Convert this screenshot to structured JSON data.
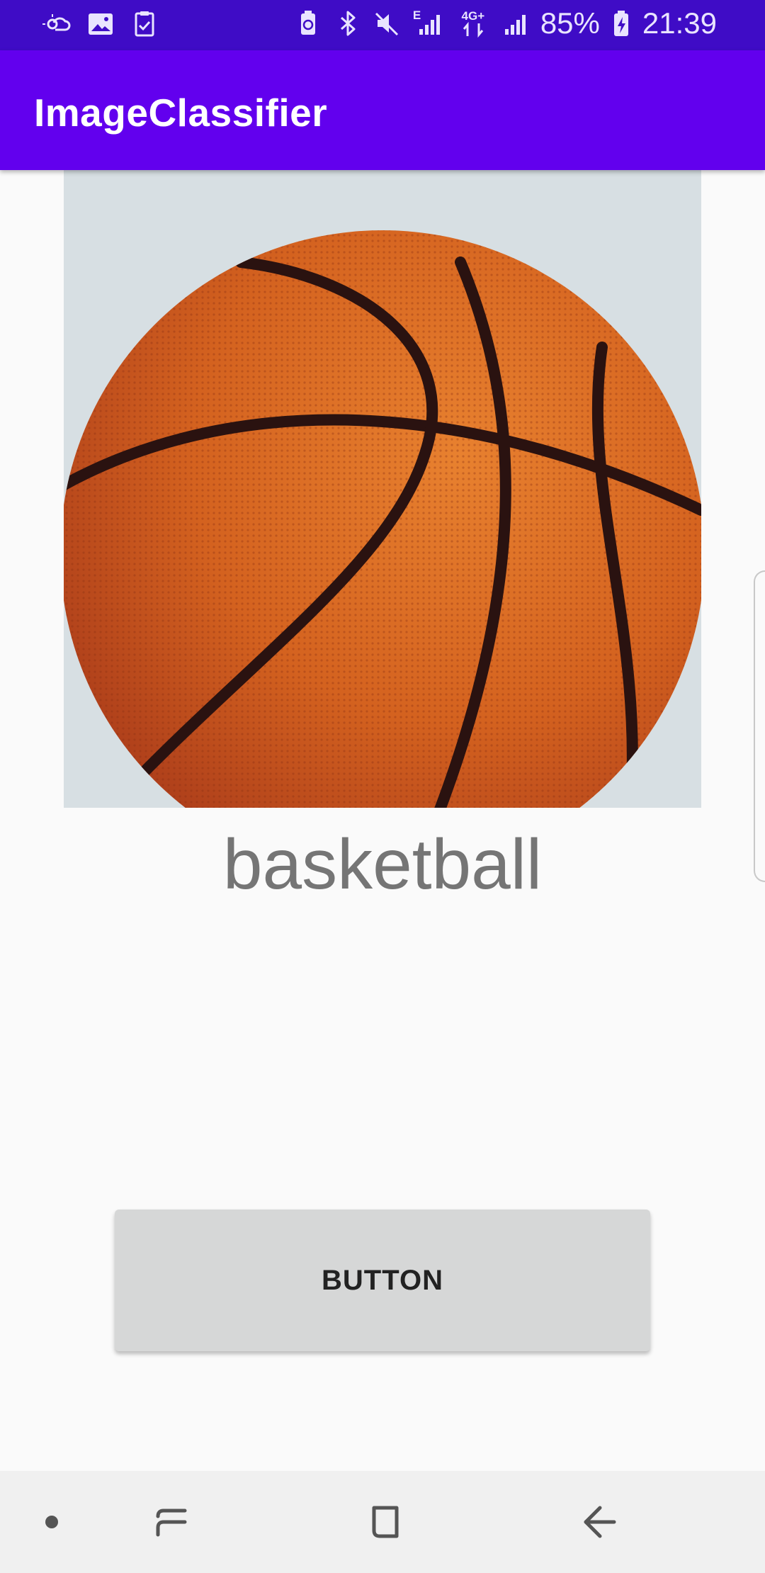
{
  "status_bar": {
    "left_icons": [
      "weather-icon",
      "gallery-icon",
      "task-icon"
    ],
    "network_type_1": "E",
    "network_type_2": "4G+",
    "battery_percent": "85%",
    "time": "21:39"
  },
  "app_bar": {
    "title": "ImageClassifier"
  },
  "classification": {
    "label": "basketball"
  },
  "action_button": {
    "label": "BUTTON"
  },
  "nav_bar": {
    "buttons": [
      "dot-icon",
      "recents-icon",
      "home-icon",
      "back-icon"
    ]
  },
  "colors": {
    "status_bar": "#3f0cc6",
    "app_bar": "#6200ee",
    "background": "#fafafa",
    "button": "#d6d7d7",
    "result_text": "#757575"
  }
}
